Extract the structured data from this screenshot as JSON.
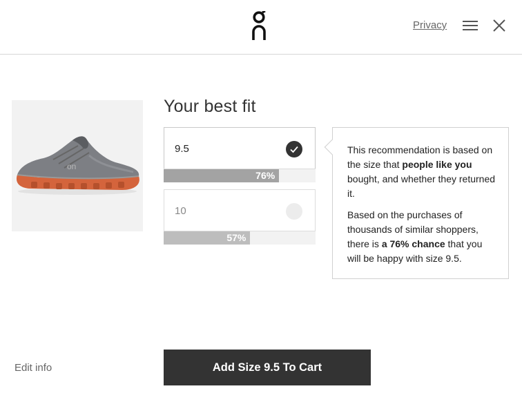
{
  "header": {
    "logo_icon": "on-logo-icon",
    "privacy_label": "Privacy",
    "menu_icon": "hamburger-menu-icon",
    "close_icon": "close-icon"
  },
  "product": {
    "image_icon": "running-shoe-image",
    "image_colors": {
      "upper": "#7d7f84",
      "sole": "#d4643c"
    }
  },
  "main": {
    "title": "Your best fit",
    "sizes": [
      {
        "label": "9.5",
        "fit_percent_text": "76%",
        "fit_percent": 76,
        "selected": true
      },
      {
        "label": "10",
        "fit_percent_text": "57%",
        "fit_percent": 57,
        "selected": false
      }
    ]
  },
  "tooltip": {
    "p1_before": "This recommendation is based on the size that ",
    "p1_bold": "people like you",
    "p1_after": " bought, and whether they returned it.",
    "p2_before": "Based on the purchases of thousands of similar shoppers, there is ",
    "p2_bold": "a 76% chance",
    "p2_after": " that you will be happy with size 9.5."
  },
  "footer": {
    "edit_label": "Edit info",
    "cart_button_label": "Add Size 9.5 To Cart"
  },
  "colors": {
    "button_bg": "#333333",
    "bar_selected": "#a3a3a3",
    "bar_alt": "#bdbdbd"
  }
}
